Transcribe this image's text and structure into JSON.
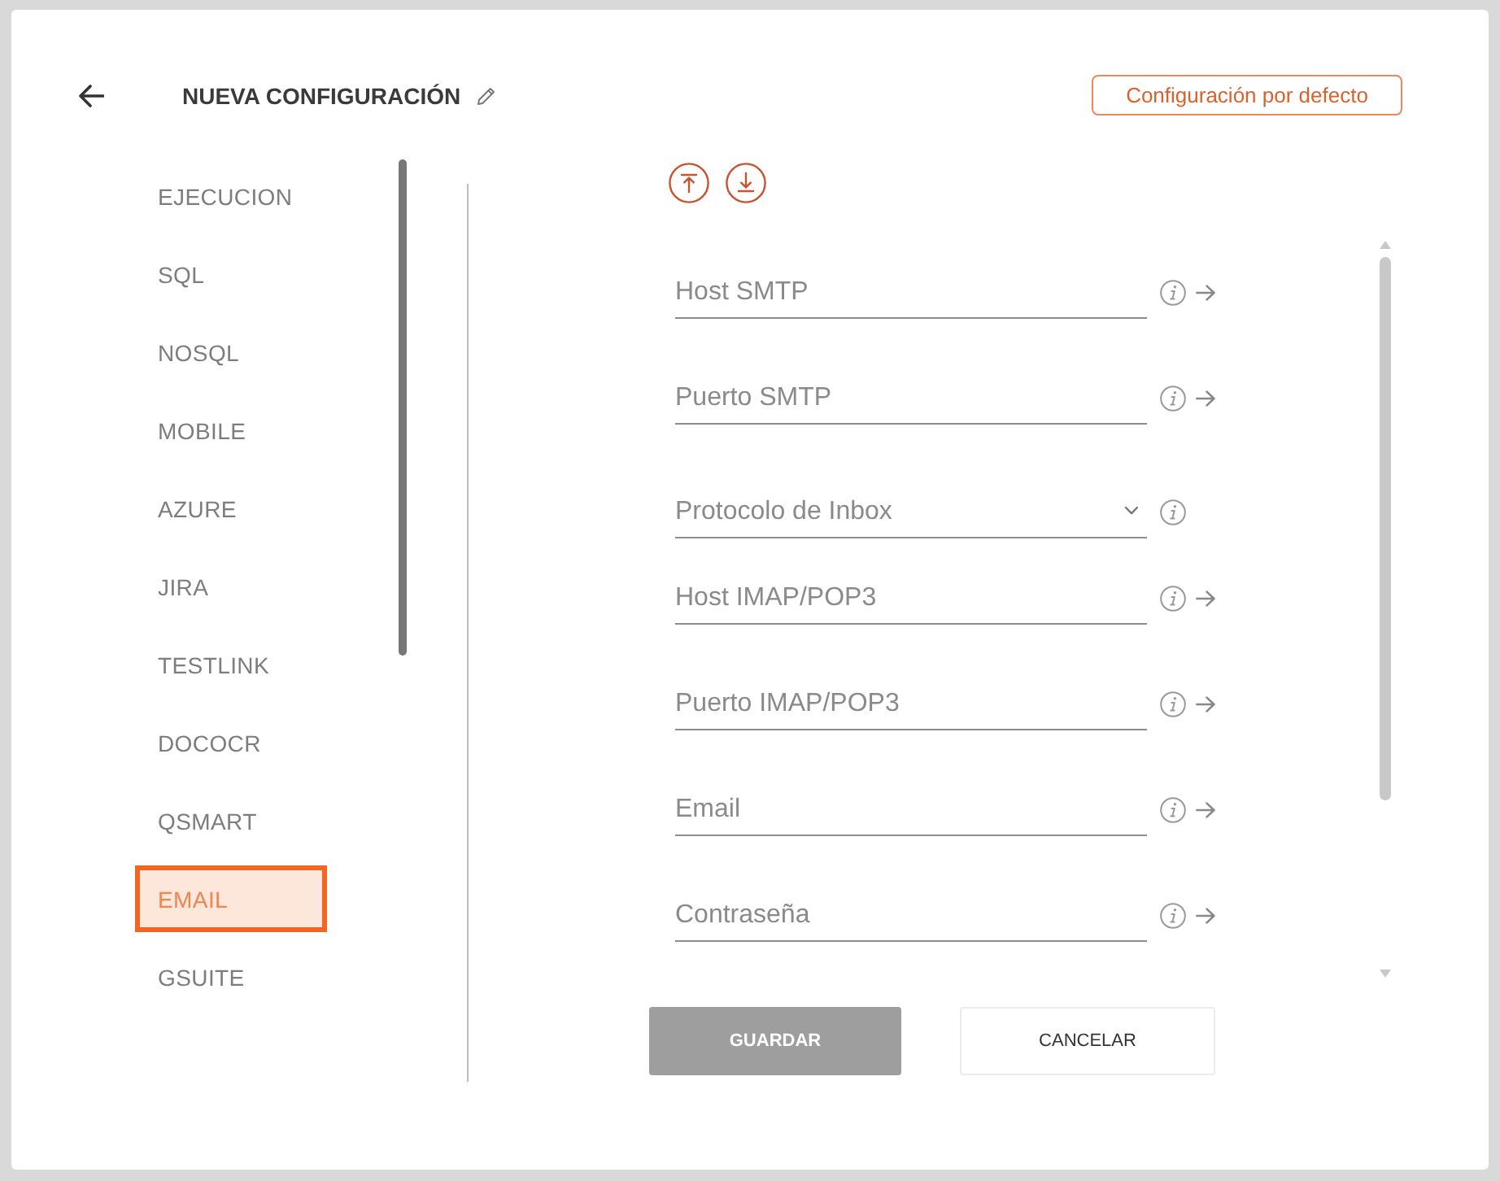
{
  "header": {
    "title": "NUEVA CONFIGURACIÓN",
    "default_button": "Configuración por defecto"
  },
  "sidebar": {
    "items": [
      {
        "label": "EJECUCION",
        "selected": false
      },
      {
        "label": "SQL",
        "selected": false
      },
      {
        "label": "NOSQL",
        "selected": false
      },
      {
        "label": "MOBILE",
        "selected": false
      },
      {
        "label": "AZURE",
        "selected": false
      },
      {
        "label": "JIRA",
        "selected": false
      },
      {
        "label": "TESTLINK",
        "selected": false
      },
      {
        "label": "DOCOCR",
        "selected": false
      },
      {
        "label": "QSMART",
        "selected": false
      },
      {
        "label": "EMAIL",
        "selected": true
      },
      {
        "label": "GSUITE",
        "selected": false
      }
    ]
  },
  "form": {
    "fields": [
      {
        "kind": "text",
        "placeholder": "Host SMTP"
      },
      {
        "kind": "text",
        "placeholder": "Puerto SMTP"
      },
      {
        "kind": "select",
        "placeholder": "Protocolo de Inbox"
      },
      {
        "kind": "text",
        "placeholder": "Host IMAP/POP3"
      },
      {
        "kind": "text",
        "placeholder": "Puerto IMAP/POP3"
      },
      {
        "kind": "text",
        "placeholder": "Email"
      },
      {
        "kind": "text",
        "placeholder": "Contraseña"
      }
    ]
  },
  "buttons": [
    {
      "label": "GUARDAR",
      "disabled": true
    },
    {
      "label": "CANCELAR",
      "disabled": false
    }
  ]
}
